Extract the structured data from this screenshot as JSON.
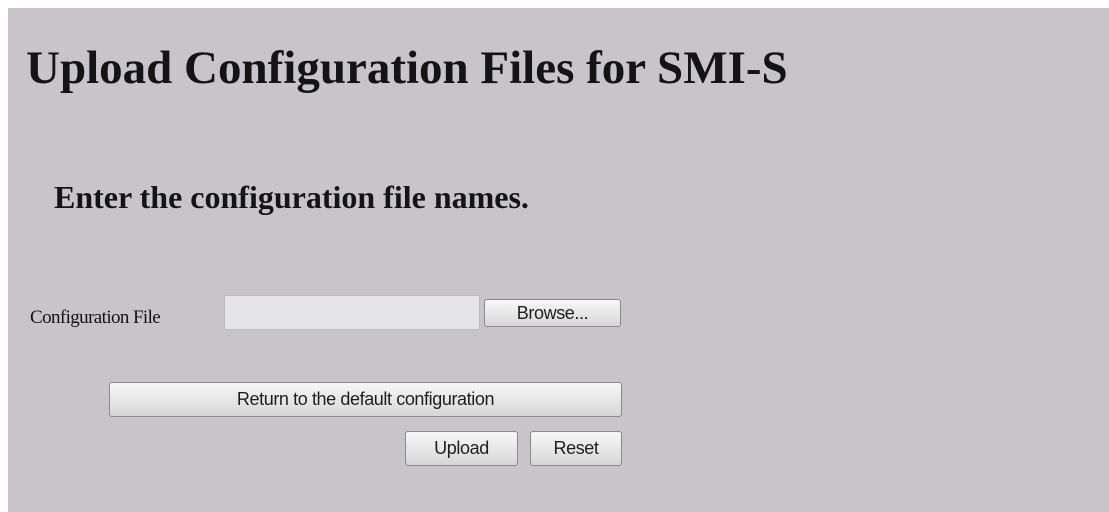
{
  "page": {
    "title": "Upload Configuration Files for SMI-S",
    "subtitle": "Enter the configuration file names."
  },
  "form": {
    "file_label": "Configuration File",
    "file_value": "",
    "browse_label": "Browse...",
    "default_config_label": "Return to the default configuration",
    "upload_label": "Upload",
    "reset_label": "Reset"
  },
  "colors": {
    "panel_background": "#c7c5c9",
    "text": "#141414"
  }
}
